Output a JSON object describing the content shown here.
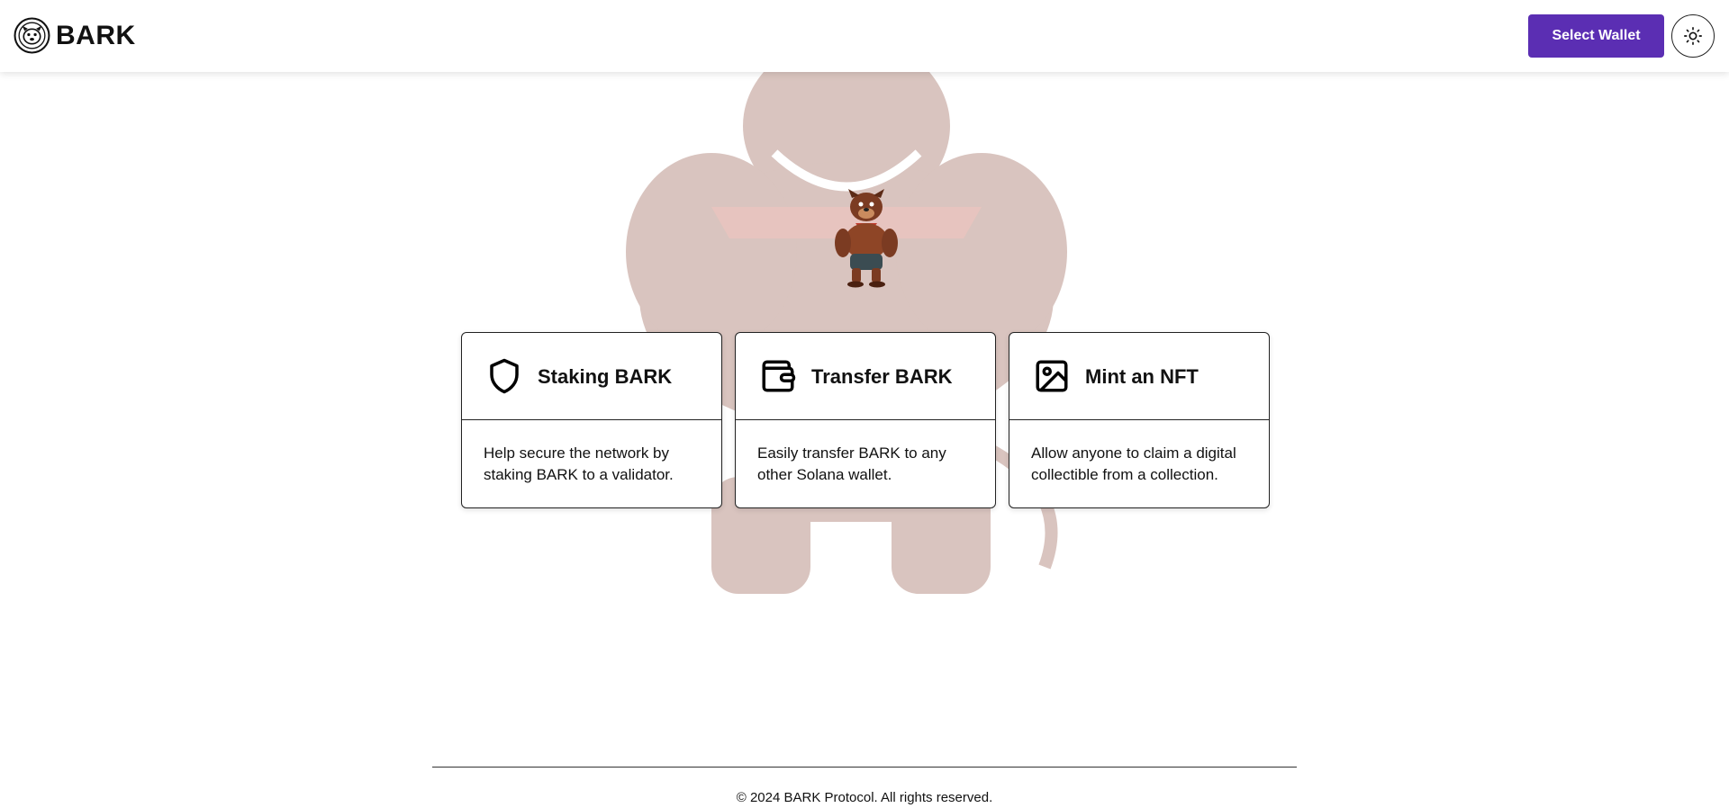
{
  "header": {
    "brand_name": "BARK",
    "logo_icon": "bark-logo-icon",
    "wallet_button": "Select Wallet",
    "theme_toggle_icon": "sun-icon"
  },
  "hero": {
    "background_image": "bark-mascot-large-faded",
    "foreground_image": "bark-mascot-small"
  },
  "cards": [
    {
      "icon": "shield-icon",
      "title": "Staking BARK",
      "description": "Help secure the network by staking BARK to a validator."
    },
    {
      "icon": "wallet-icon",
      "title": "Transfer BARK",
      "description": "Easily transfer BARK to any other Solana wallet."
    },
    {
      "icon": "image-icon",
      "title": "Mint an NFT",
      "description": "Allow anyone to claim a digital collectible from a collection."
    }
  ],
  "footer": {
    "copyright": "© 2024 BARK Protocol. All rights reserved."
  },
  "colors": {
    "accent": "#5b2eb3",
    "text": "#111111",
    "border": "#222222",
    "background": "#ffffff"
  }
}
